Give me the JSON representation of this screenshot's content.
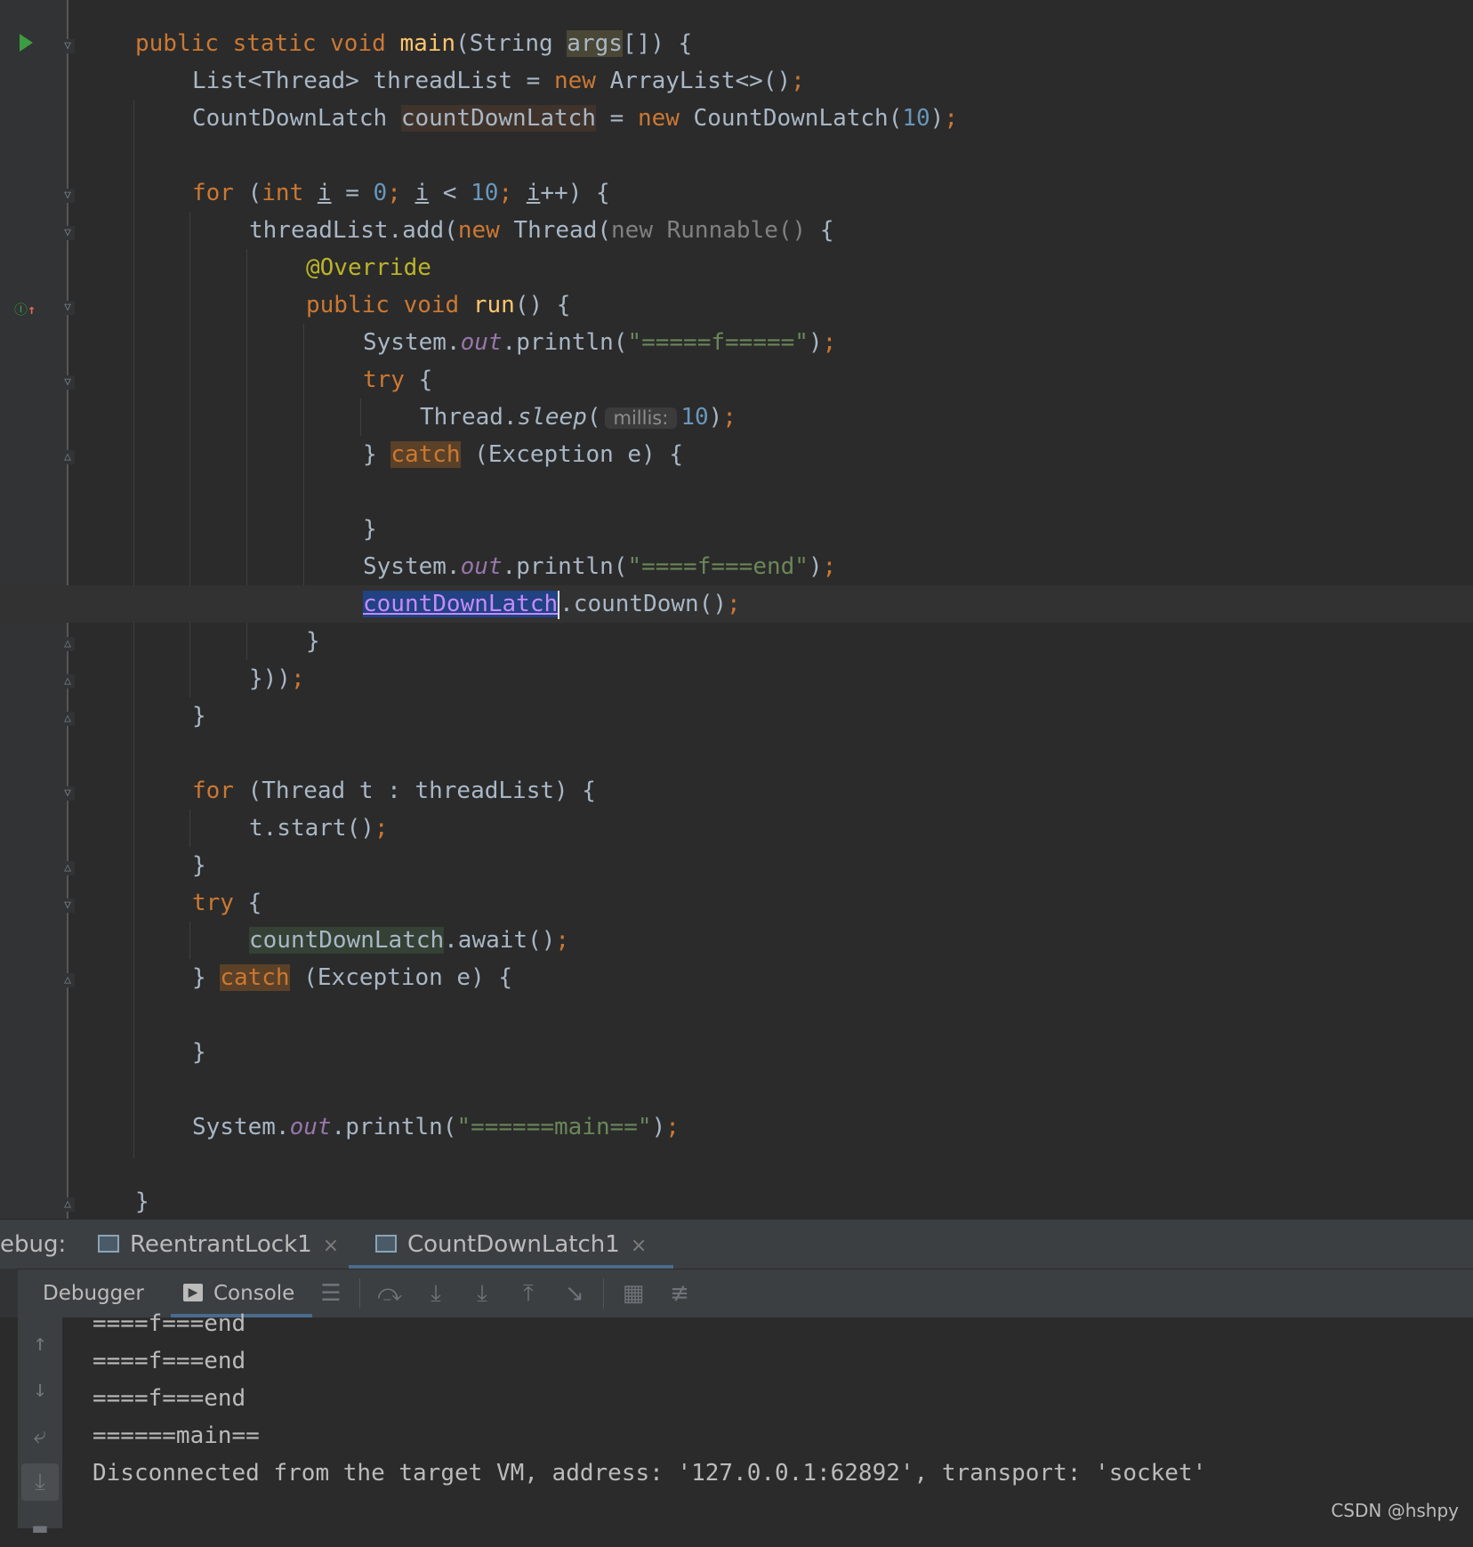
{
  "code_lines": [
    {
      "indent": 0,
      "tokens": []
    },
    {
      "indent": 0,
      "tokens": []
    },
    {
      "indent": 0,
      "tokens": []
    },
    {
      "indent": 0,
      "tokens": []
    }
  ],
  "code": {
    "l1": {
      "public": "public",
      "static": "static",
      "void": "void",
      "main": "main",
      "paren": "(String ",
      "args": "args",
      "rest": "[]) {"
    },
    "l2": {
      "a": "List<Thread> threadList = ",
      "new": "new",
      "b": " ArrayList<>()",
      "semi": ";"
    },
    "l3": {
      "a": "CountDownLatch ",
      "var": "countDownLatch",
      "b": " = ",
      "new": "new",
      "c": " CountDownLatch(",
      "num": "10",
      "d": ")",
      "semi": ";"
    },
    "l5": {
      "for": "for",
      "a": " (",
      "int": "int",
      "b": " ",
      "i1": "i",
      "c": " = ",
      "zero": "0",
      "s1": "; ",
      "i2": "i",
      "d": " < ",
      "ten": "10",
      "s2": "; ",
      "i3": "i",
      "e": "++) {"
    },
    "l6": {
      "a": "threadList.add(",
      "new": "new",
      "b": " Thread(",
      "new2": "new Runnable()",
      "c": " {"
    },
    "l7": {
      "ann": "@Override"
    },
    "l8": {
      "public": "public",
      "void": "void",
      "run": "run",
      "rest": "() {"
    },
    "l9": {
      "a": "System.",
      "out": "out",
      "b": ".println(",
      "str": "\"=====f=====\"",
      "c": ")",
      "semi": ";"
    },
    "l10": {
      "try": "try",
      "rest": " {"
    },
    "l11": {
      "a": "Thread.",
      "sleep": "sleep",
      "b": "(",
      "hint": "millis:",
      "num": "10",
      "c": ")",
      "semi": ";"
    },
    "l12": {
      "a": "} ",
      "catch": "catch",
      "b": " (Exception e) {"
    },
    "l14": {
      "a": "}"
    },
    "l15": {
      "a": "System.",
      "out": "out",
      "b": ".println(",
      "str": "\"====f===end\"",
      "c": ")",
      "semi": ";"
    },
    "l16": {
      "var": "countDownLatch",
      "b": ".countDown()",
      "semi": ";"
    },
    "l17": {
      "a": "}"
    },
    "l18": {
      "a": "}))",
      "semi": ";"
    },
    "l19": {
      "a": "}"
    },
    "l21": {
      "for": "for",
      "a": " (Thread t : threadList) {"
    },
    "l22": {
      "a": "t.start()",
      "semi": ";"
    },
    "l23": {
      "a": "}"
    },
    "l24": {
      "try": "try",
      "rest": " {"
    },
    "l25": {
      "var": "countDownLatch",
      "b": ".await()",
      "semi": ";"
    },
    "l26": {
      "a": "} ",
      "catch": "catch",
      "b": " (Exception e) {"
    },
    "l28": {
      "a": "}"
    },
    "l30": {
      "a": "System.",
      "out": "out",
      "b": ".println(",
      "str": "\"======main==\"",
      "c": ")",
      "semi": ";"
    },
    "l32": {
      "a": "}"
    }
  },
  "debug": {
    "label": "ebug:",
    "tabs": [
      {
        "label": "ReentrantLock1",
        "close": "×"
      },
      {
        "label": "CountDownLatch1",
        "close": "×"
      }
    ],
    "subtabs": {
      "debugger": "Debugger",
      "console": "Console"
    }
  },
  "console_lines": [
    "====f===end",
    "====f===end",
    "====f===end",
    "======main==",
    "Disconnected from the target VM, address: '127.0.0.1:62892', transport: 'socket'"
  ],
  "watermark": "CSDN @hshpy"
}
